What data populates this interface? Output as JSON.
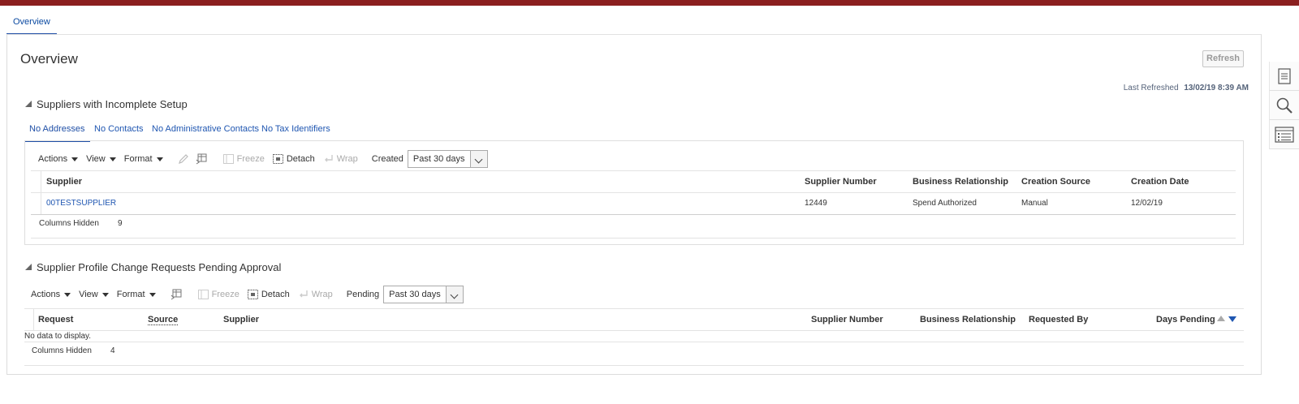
{
  "top_tab": "Overview",
  "page_title": "Overview",
  "refresh_label": "Refresh",
  "last_refreshed": {
    "label": "Last Refreshed",
    "value": "13/02/19 8:39 AM"
  },
  "section1": {
    "title": "Suppliers with Incomplete Setup",
    "tabs": [
      "No Addresses",
      "No Contacts",
      "No Administrative Contacts",
      "No Tax Identifiers"
    ],
    "toolbar": {
      "actions": "Actions",
      "view": "View",
      "format": "Format",
      "freeze": "Freeze",
      "detach": "Detach",
      "wrap": "Wrap",
      "filter_label": "Created",
      "filter_value": "Past 30 days"
    },
    "columns": [
      "Supplier",
      "Supplier Number",
      "Business Relationship",
      "Creation Source",
      "Creation Date"
    ],
    "rows": [
      {
        "supplier": "00TESTSUPPLIER",
        "number": "12449",
        "relationship": "Spend Authorized",
        "source": "Manual",
        "date": "12/02/19"
      }
    ],
    "columns_hidden_label": "Columns Hidden",
    "columns_hidden_count": "9"
  },
  "section2": {
    "title": "Supplier Profile Change Requests Pending Approval",
    "toolbar": {
      "actions": "Actions",
      "view": "View",
      "format": "Format",
      "freeze": "Freeze",
      "detach": "Detach",
      "wrap": "Wrap",
      "filter_label": "Pending",
      "filter_value": "Past 30 days"
    },
    "columns": [
      "Request",
      "Source",
      "Supplier",
      "Supplier Number",
      "Business Relationship",
      "Requested By",
      "Days Pending"
    ],
    "empty_text": "No data to display.",
    "columns_hidden_label": "Columns Hidden",
    "columns_hidden_count": "4"
  },
  "rail_icons": [
    "document-icon",
    "search-icon",
    "list-icon"
  ]
}
